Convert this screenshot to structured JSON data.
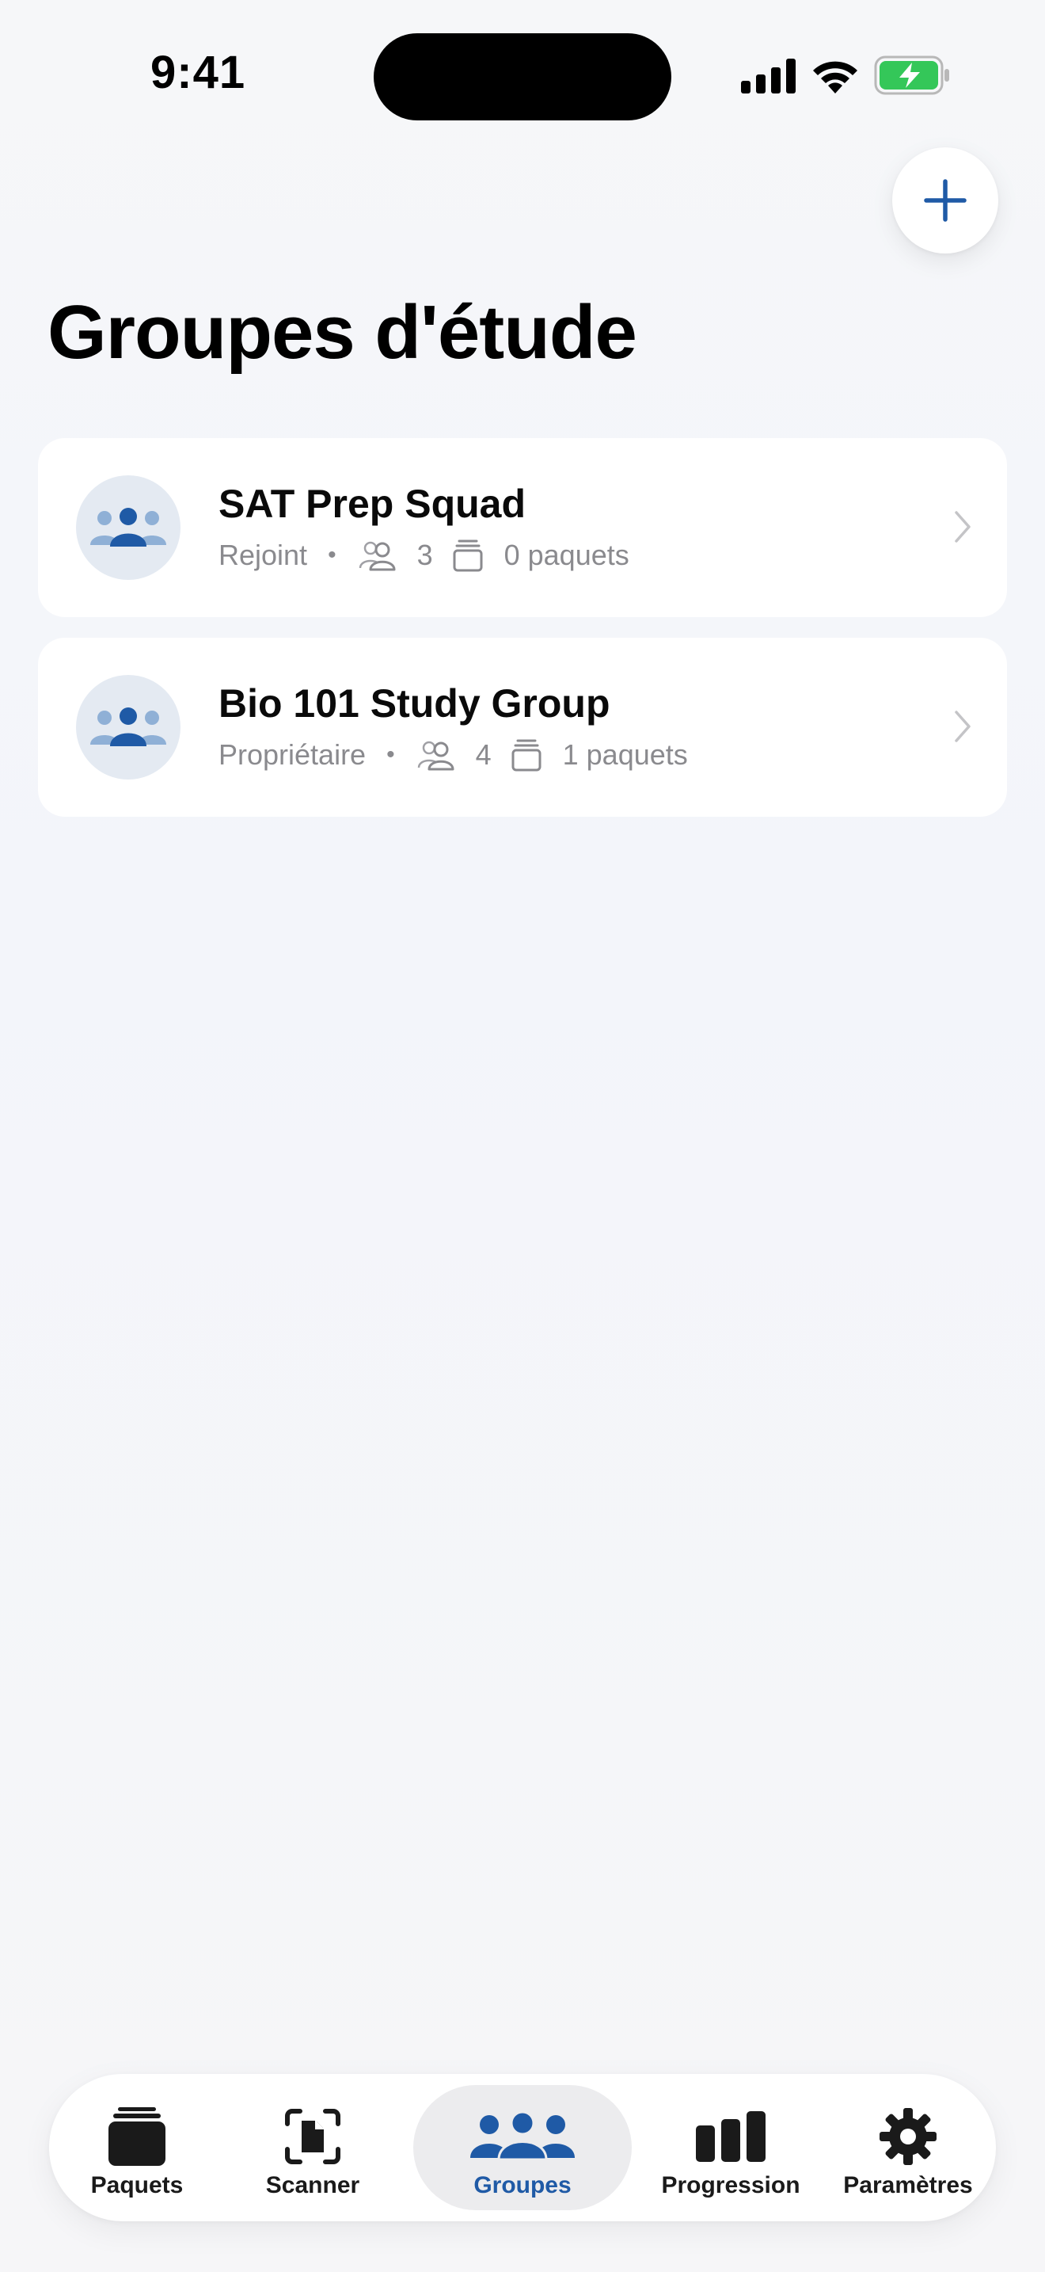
{
  "status_bar": {
    "time": "9:41",
    "battery_color": "#34c759"
  },
  "header": {
    "title": "Groupes d'étude",
    "add_icon": "plus-icon"
  },
  "accent_color": "#1f5aa6",
  "groups": [
    {
      "name": "SAT Prep Squad",
      "role": "Rejoint",
      "members": "3",
      "decks": "0 paquets"
    },
    {
      "name": "Bio 101 Study Group",
      "role": "Propriétaire",
      "members": "4",
      "decks": "1 paquets"
    }
  ],
  "separator": "•",
  "tab_bar": {
    "active": "Groupes",
    "items": [
      {
        "label": "Paquets",
        "icon": "decks-icon"
      },
      {
        "label": "Scanner",
        "icon": "scan-icon"
      },
      {
        "label": "Groupes",
        "icon": "groups-icon"
      },
      {
        "label": "Progression",
        "icon": "bar-chart-icon"
      },
      {
        "label": "Paramètres",
        "icon": "gear-icon"
      }
    ]
  }
}
